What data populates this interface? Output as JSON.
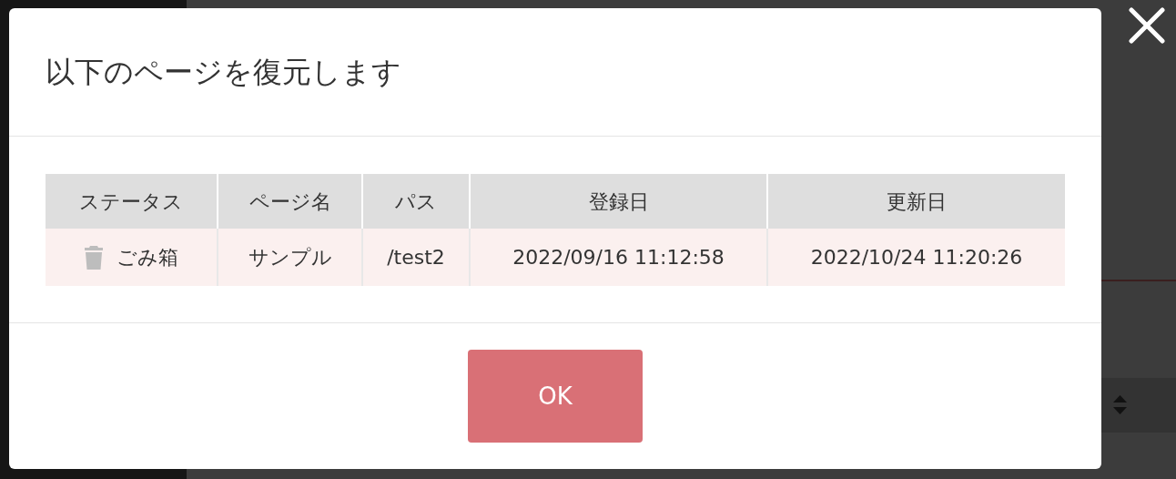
{
  "dialog": {
    "title": "以下のページを復元します",
    "table": {
      "columns": [
        "ステータス",
        "ページ名",
        "パス",
        "登録日",
        "更新日"
      ],
      "rows": [
        {
          "status": "ごみ箱",
          "page_name": "サンプル",
          "path": "/test2",
          "registered": "2022/09/16 11:12:58",
          "updated": "2022/10/24 11:20:26"
        }
      ]
    },
    "ok_button": "OK"
  }
}
